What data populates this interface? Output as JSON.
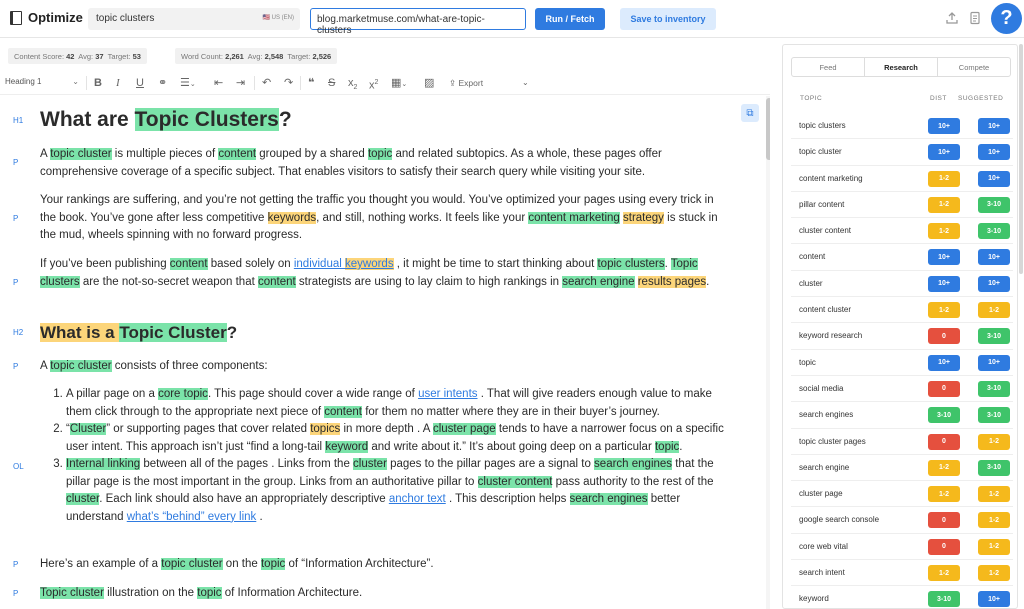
{
  "app": {
    "brand": "Optimize"
  },
  "search": {
    "query": "topic clusters",
    "language": "🇺🇸 US (EN)",
    "url": "blog.marketmuse.com/what-are-topic-clusters"
  },
  "actions": {
    "run_label": "Run / Fetch",
    "save_label": "Save to inventory",
    "help_label": "?"
  },
  "scores": {
    "content": {
      "label": "Content Score:",
      "value": "42",
      "avg_label": "Avg:",
      "avg": "37",
      "target_label": "Target:",
      "target": "53"
    },
    "words": {
      "label": "Word Count:",
      "value": "2,261",
      "avg_label": "Avg:",
      "avg": "2,548",
      "target_label": "Target:",
      "target": "2,526"
    }
  },
  "toolbar": {
    "heading_select": "Heading 1",
    "export_label": "Export"
  },
  "gutter": [
    "H1",
    "P",
    "P",
    "P",
    "H2",
    "P",
    "OL",
    "P",
    "P"
  ],
  "panel": {
    "tabs": [
      "Feed",
      "Research",
      "Compete"
    ],
    "active_tab": "Research",
    "columns": {
      "topic": "TOPIC",
      "dist": "DIST",
      "suggested": "SUGGESTED"
    },
    "rows": [
      {
        "topic": "topic clusters",
        "dist": "10+",
        "dist_color": "blue",
        "sugg": "10+",
        "sugg_color": "blue"
      },
      {
        "topic": "topic cluster",
        "dist": "10+",
        "dist_color": "blue",
        "sugg": "10+",
        "sugg_color": "blue"
      },
      {
        "topic": "content marketing",
        "dist": "1-2",
        "dist_color": "yellow",
        "sugg": "10+",
        "sugg_color": "blue"
      },
      {
        "topic": "pillar content",
        "dist": "1-2",
        "dist_color": "yellow",
        "sugg": "3-10",
        "sugg_color": "green"
      },
      {
        "topic": "cluster content",
        "dist": "1-2",
        "dist_color": "yellow",
        "sugg": "3-10",
        "sugg_color": "green"
      },
      {
        "topic": "content",
        "dist": "10+",
        "dist_color": "blue",
        "sugg": "10+",
        "sugg_color": "blue"
      },
      {
        "topic": "cluster",
        "dist": "10+",
        "dist_color": "blue",
        "sugg": "10+",
        "sugg_color": "blue"
      },
      {
        "topic": "content cluster",
        "dist": "1-2",
        "dist_color": "yellow",
        "sugg": "1-2",
        "sugg_color": "yellow"
      },
      {
        "topic": "keyword research",
        "dist": "0",
        "dist_color": "red",
        "sugg": "3-10",
        "sugg_color": "green"
      },
      {
        "topic": "topic",
        "dist": "10+",
        "dist_color": "blue",
        "sugg": "10+",
        "sugg_color": "blue"
      },
      {
        "topic": "social media",
        "dist": "0",
        "dist_color": "red",
        "sugg": "3-10",
        "sugg_color": "green"
      },
      {
        "topic": "search engines",
        "dist": "3-10",
        "dist_color": "green",
        "sugg": "3-10",
        "sugg_color": "green"
      },
      {
        "topic": "topic cluster pages",
        "dist": "0",
        "dist_color": "red",
        "sugg": "1-2",
        "sugg_color": "yellow"
      },
      {
        "topic": "search engine",
        "dist": "1-2",
        "dist_color": "yellow",
        "sugg": "3-10",
        "sugg_color": "green"
      },
      {
        "topic": "cluster page",
        "dist": "1-2",
        "dist_color": "yellow",
        "sugg": "1-2",
        "sugg_color": "yellow"
      },
      {
        "topic": "google search console",
        "dist": "0",
        "dist_color": "red",
        "sugg": "1-2",
        "sugg_color": "yellow"
      },
      {
        "topic": "core web vital",
        "dist": "0",
        "dist_color": "red",
        "sugg": "1-2",
        "sugg_color": "yellow"
      },
      {
        "topic": "search intent",
        "dist": "1-2",
        "dist_color": "yellow",
        "sugg": "1-2",
        "sugg_color": "yellow"
      },
      {
        "topic": "keyword",
        "dist": "3-10",
        "dist_color": "green",
        "sugg": "10+",
        "sugg_color": "blue"
      }
    ]
  },
  "doc": {
    "h1": [
      {
        "t": "What are "
      },
      {
        "t": "Topic Clusters",
        "h": "g"
      },
      {
        "t": "?"
      }
    ],
    "h1_pre": "What are ",
    "p1": [
      {
        "t": "A "
      },
      {
        "t": "topic cluster",
        "h": "g"
      },
      {
        "t": " is multiple pieces of "
      },
      {
        "t": "content",
        "h": "g"
      },
      {
        "t": " grouped by a shared "
      },
      {
        "t": "topic",
        "h": "g"
      },
      {
        "t": " and related subtopics. As a whole, these pages offer comprehensive coverage of a specific subject. That enables visitors to satisfy their search query while visiting your site."
      }
    ],
    "p2": [
      {
        "t": "Your rankings are suffering, and you’re not getting the traffic you thought you would. You’ve optimized your pages using every trick in the book. You’ve gone after less competitive "
      },
      {
        "t": "keywords",
        "h": "y"
      },
      {
        "t": ", and still, nothing works. It feels like your "
      },
      {
        "t": "content marketing",
        "h": "g"
      },
      {
        "t": " "
      },
      {
        "t": "strategy",
        "h": "y"
      },
      {
        "t": " is stuck in the mud, wheels spinning with no forward progress."
      }
    ],
    "p3": [
      {
        "t": "If you’ve been publishing "
      },
      {
        "t": "content",
        "h": "g"
      },
      {
        "t": " based solely on "
      },
      {
        "t": "individual ",
        "h": "lk"
      },
      {
        "t": "keywords",
        "h": "lky"
      },
      {
        "t": " , it might be time to start thinking about "
      },
      {
        "t": "topic clusters",
        "h": "g"
      },
      {
        "t": ". "
      },
      {
        "t": "Topic clusters",
        "h": "g"
      },
      {
        "t": " are the not-so-secret weapon that "
      },
      {
        "t": "content",
        "h": "g"
      },
      {
        "t": " strategists are using to lay claim to high rankings in "
      },
      {
        "t": "search engine",
        "h": "g"
      },
      {
        "t": " "
      },
      {
        "t": "results pages",
        "h": "y"
      },
      {
        "t": "."
      }
    ],
    "h2": [
      {
        "t": "What is a ",
        "h": "y"
      },
      {
        "t": "Topic Cluster",
        "h": "g"
      },
      {
        "t": "?"
      }
    ],
    "p4": [
      {
        "t": "A "
      },
      {
        "t": "topic cluster",
        "h": "g"
      },
      {
        "t": " consists of three components:"
      }
    ],
    "ol": [
      [
        {
          "t": "A pillar page on a "
        },
        {
          "t": "core topic",
          "h": "g"
        },
        {
          "t": ". This page should cover a wide range of "
        },
        {
          "t": "user intents",
          "h": "lk"
        },
        {
          "t": " . That will give readers enough value to make them click through to the appropriate next piece of "
        },
        {
          "t": "content",
          "h": "g"
        },
        {
          "t": " for them no matter where they are in their buyer’s journey."
        }
      ],
      [
        {
          "t": "“"
        },
        {
          "t": "Cluster",
          "h": "g"
        },
        {
          "t": "” or supporting pages that cover related "
        },
        {
          "t": "topics",
          "h": "y"
        },
        {
          "t": " in more depth . A "
        },
        {
          "t": "cluster page",
          "h": "g"
        },
        {
          "t": " tends to have a narrower focus on a specific user intent. This approach isn’t just “find a long-tail "
        },
        {
          "t": "keyword",
          "h": "g"
        },
        {
          "t": " and write about it.” It’s about going deep on a particular "
        },
        {
          "t": "topic",
          "h": "g"
        },
        {
          "t": "."
        }
      ],
      [
        {
          "t": "Internal linking",
          "h": "g"
        },
        {
          "t": " between all of the pages . Links from the "
        },
        {
          "t": "cluster",
          "h": "g"
        },
        {
          "t": " pages to the pillar pages are a signal to "
        },
        {
          "t": "search engines",
          "h": "g"
        },
        {
          "t": " that the pillar page is the most important in the group. Links from an authoritative pillar to "
        },
        {
          "t": "cluster content",
          "h": "g"
        },
        {
          "t": " pass authority to the rest of the "
        },
        {
          "t": "cluster",
          "h": "g"
        },
        {
          "t": ". Each link should also have an appropriately descriptive "
        },
        {
          "t": "anchor text",
          "h": "lk"
        },
        {
          "t": " . This description helps "
        },
        {
          "t": "search engines",
          "h": "g"
        },
        {
          "t": " better understand "
        },
        {
          "t": "what’s “behind” every link",
          "h": "lk"
        },
        {
          "t": " ."
        }
      ]
    ],
    "p5": [
      {
        "t": "Here’s an example of a "
      },
      {
        "t": "topic cluster",
        "h": "g"
      },
      {
        "t": " on the "
      },
      {
        "t": "topic",
        "h": "g"
      },
      {
        "t": " of “Information Architecture”."
      }
    ],
    "p6": [
      {
        "t": "Topic cluster",
        "h": "g"
      },
      {
        "t": " illustration on the "
      },
      {
        "t": "topic",
        "h": "g"
      },
      {
        "t": " of Information Architecture."
      }
    ]
  }
}
